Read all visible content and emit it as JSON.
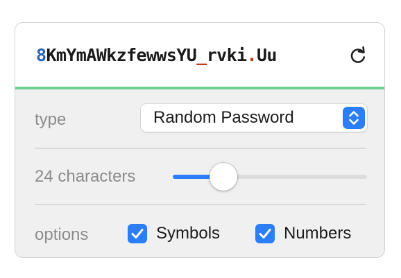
{
  "password": {
    "segments": [
      {
        "text": "8",
        "kind": "digit"
      },
      {
        "text": "KmYmAWkzfewwsYU",
        "kind": "letter"
      },
      {
        "text": "_",
        "kind": "symbol"
      },
      {
        "text": "rvki",
        "kind": "letter"
      },
      {
        "text": ".",
        "kind": "symbol"
      },
      {
        "text": "Uu",
        "kind": "letter"
      }
    ],
    "strength_color": "#6dd08f",
    "digit_color": "#2763b8",
    "symbol_color": "#c0391b"
  },
  "refresh": {
    "icon": "refresh-icon"
  },
  "type_row": {
    "label": "type",
    "selected": "Random Password",
    "icon": "chevron-up-down-icon"
  },
  "length_row": {
    "label": "24 characters",
    "slider_fraction": 0.22
  },
  "options_row": {
    "label": "options",
    "symbols": {
      "label": "Symbols",
      "checked": true
    },
    "numbers": {
      "label": "Numbers",
      "checked": true
    }
  },
  "accent_color": "#2b7ef7"
}
